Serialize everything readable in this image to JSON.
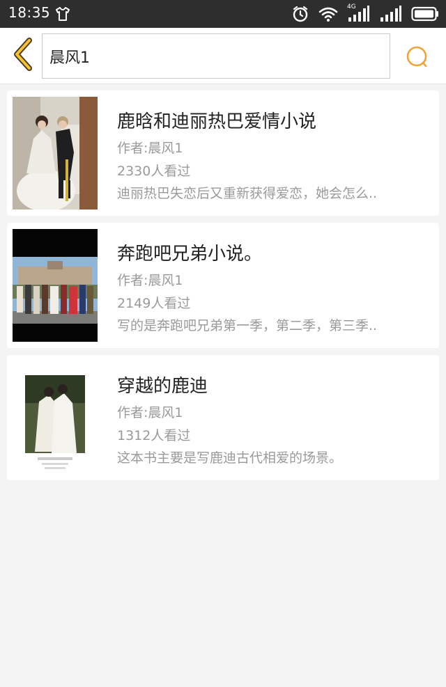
{
  "status_bar": {
    "time": "18:35",
    "network_label": "4G",
    "icons": [
      "tshirt-icon",
      "alarm-icon",
      "wifi-icon",
      "cell-signal-icon",
      "battery-icon"
    ]
  },
  "search": {
    "query": "晨风1",
    "accent_color": "#f0a33a"
  },
  "results": [
    {
      "title": "鹿晗和迪丽热巴爱情小说",
      "author": "作者:晨风1",
      "views": "2330人看过",
      "description": "迪丽热巴失恋后又重新获得爱恋，她会怎么.."
    },
    {
      "title": "奔跑吧兄弟小说。",
      "author": "作者:晨风1",
      "views": "2149人看过",
      "description": "写的是奔跑吧兄弟第一季，第二季，第三季.."
    },
    {
      "title": "穿越的鹿迪",
      "author": "作者:晨风1",
      "views": "1312人看过",
      "description": "这本书主要是写鹿迪古代相爱的场景。"
    }
  ]
}
